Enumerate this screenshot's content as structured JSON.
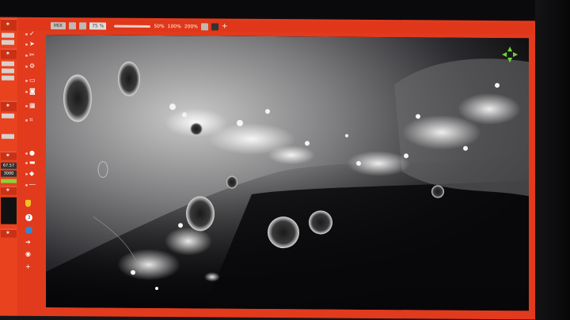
{
  "toolbar": {
    "mix_label": "MIX",
    "zoom_value": "75 %",
    "scale_options": [
      "50%",
      "100%",
      "200%"
    ],
    "add_label": "+"
  },
  "left_panel": {
    "value_a": "67.57",
    "value_b": "3000"
  },
  "tools": {
    "badge_number": "3"
  },
  "icons": {
    "toolbar": [
      "monitor-icon",
      "camera-icon",
      "slider-icon",
      "contrast-icon",
      "invert-icon",
      "plus-icon"
    ],
    "tools": [
      "check-icon",
      "pointer-icon",
      "cut-icon",
      "gear-icon",
      "folder-icon",
      "comment-icon",
      "grid-icon",
      "crop-icon",
      "circle-icon",
      "shield-icon",
      "info-icon",
      "plus-icon"
    ],
    "nav": [
      "arrow-up-icon",
      "arrow-left-icon",
      "arrow-right-icon",
      "arrow-down-icon"
    ]
  },
  "colors": {
    "ui_accent": "#e23a1d",
    "nav_green": "#6fd43a"
  },
  "image": {
    "subject": "lunar surface telescope capture"
  }
}
